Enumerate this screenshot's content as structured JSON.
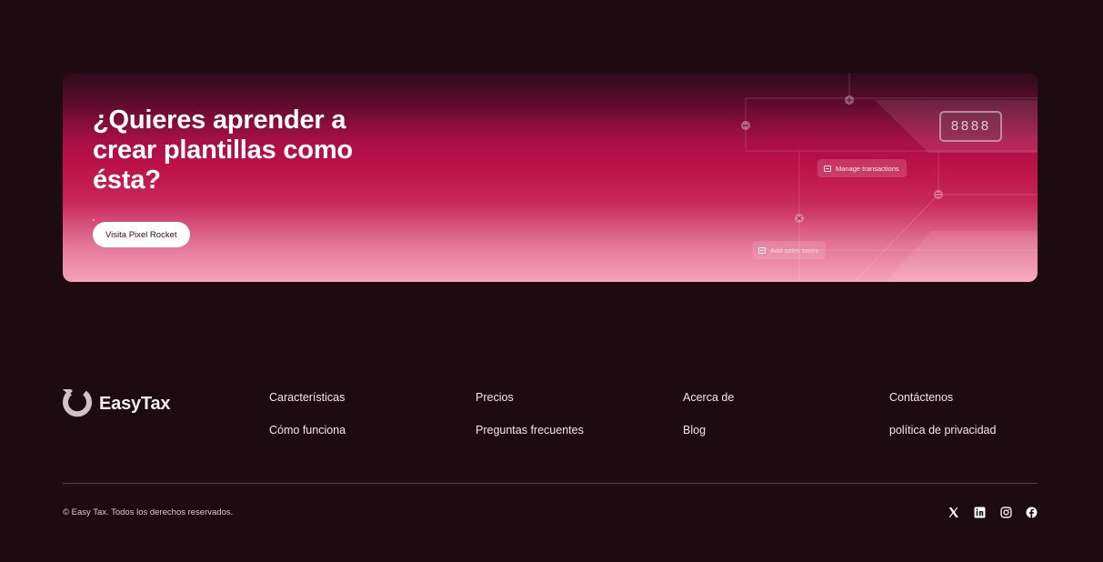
{
  "banner": {
    "heading": "¿Quieres aprender a crear plantillas como ésta?",
    "button_label": "Visita Pixel Rocket",
    "chips": {
      "manage": "Manage transactions",
      "sales": "Add sales taxes"
    },
    "display_value": "8888"
  },
  "footer": {
    "brand": "EasyTax",
    "links": {
      "caracteristicas": "Características",
      "como_funciona": "Cómo funciona",
      "precios": "Precios",
      "preguntas": "Preguntas frecuentes",
      "acerca": "Acerca de",
      "blog": "Blog",
      "contactenos": "Contáctenos",
      "privacidad": "política de privacidad"
    },
    "copyright": "© Easy Tax. Todos los derechos reservados.",
    "social_icons": [
      "x-icon",
      "linkedin-icon",
      "instagram-icon",
      "facebook-icon"
    ]
  },
  "colors": {
    "background": "#1e0b11",
    "banner_top": "#2a0c17",
    "banner_mid": "#bc1048",
    "banner_bottom": "#f6a3ba",
    "text": "#f1e8eb"
  }
}
